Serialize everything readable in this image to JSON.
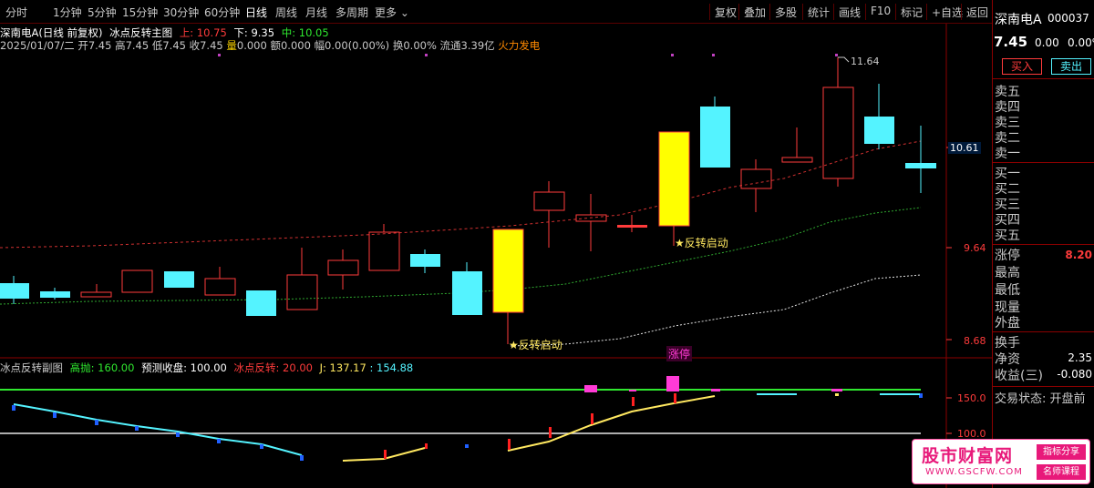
{
  "toolbar": {
    "periods": [
      "分时",
      "1分钟",
      "5分钟",
      "15分钟",
      "30分钟",
      "60分钟",
      "日线",
      "周线",
      "月线",
      "多周期",
      "更多"
    ],
    "active": "日线",
    "right_buttons": [
      "复权",
      "叠加",
      "多股",
      "统计",
      "画线",
      "F10",
      "标记",
      "+自选",
      "返回"
    ]
  },
  "info": {
    "line1_name": "深南电A(日线 前复权)",
    "line1_indicator": "冰点反转主图",
    "up_label": "上: 10.75",
    "down_label": "下: 9.35",
    "mid_label": "中: 10.05",
    "line2_date": "2025/01/07/二",
    "line2_ohlc": "开7.45 高7.45 低7.45 收7.45",
    "line2_vol_label": "量",
    "line2_vol": "0.000",
    "line2_amt": "额0.000",
    "line2_chg": "幅0.00(0.00%)",
    "line2_turn": "换0.00%",
    "line2_float": "流通3.39亿",
    "line2_concept": "火力发电"
  },
  "main_chart": {
    "price_labels": [
      "10.61",
      "9.64",
      "8.68"
    ],
    "high_label": "11.64",
    "annotations": [
      "★反转启动",
      "★反转启动",
      "涨停"
    ]
  },
  "sub_chart": {
    "title": "冰点反转副图",
    "gaopao": "高抛: 160.00",
    "yuce": "预测收盘: 100.00",
    "bingdian": "冰点反转: 20.00",
    "j": "J: 137.17",
    "k": ": 154.88",
    "axis": [
      "150.0",
      "100.0"
    ]
  },
  "right_panel": {
    "name": "深南电A",
    "code": "000037",
    "price": "7.45",
    "chg": "0.00",
    "pct": "0.00%",
    "buy_btn": "买入",
    "sell_btn": "卖出",
    "sell_levels": [
      "卖五",
      "卖四",
      "卖三",
      "卖二",
      "卖一"
    ],
    "buy_levels": [
      "买一",
      "买二",
      "买三",
      "买四",
      "买五"
    ],
    "stats": [
      {
        "label": "涨停",
        "value": "8.20"
      },
      {
        "label": "最高",
        "value": ""
      },
      {
        "label": "最低",
        "value": ""
      },
      {
        "label": "现量",
        "value": ""
      },
      {
        "label": "外盘",
        "value": ""
      },
      {
        "label": "换手",
        "value": ""
      },
      {
        "label": "净资",
        "value": "2.35"
      },
      {
        "label": "收益(三)",
        "value": "-0.080"
      }
    ],
    "trade_status": "交易状态: 开盘前"
  },
  "logo": {
    "title": "股市财富网",
    "url": "WWW.GSCFW.COM",
    "tag1": "指标分享",
    "tag2": "名师课程"
  },
  "colors": {
    "up": "#ff3b3b",
    "down": "#54f3ff",
    "yellow": "#ffff00",
    "bg": "#000000"
  }
}
